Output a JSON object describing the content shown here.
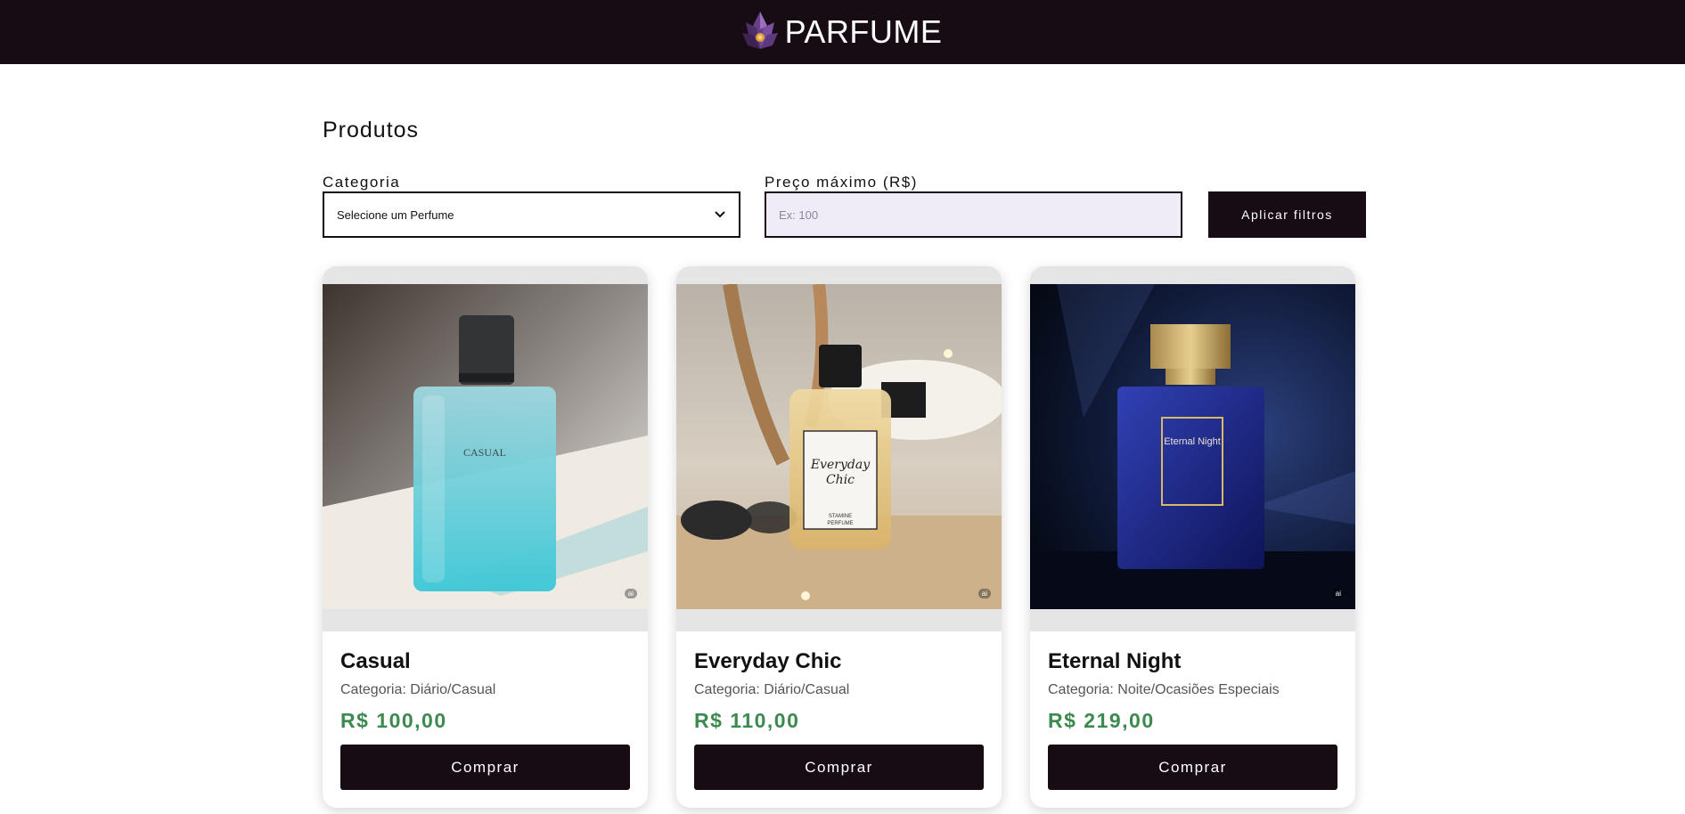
{
  "header": {
    "brand_name": "PARFUME",
    "logo_icon": "crystal-flower-logo"
  },
  "main": {
    "title": "Produtos",
    "filters": {
      "category_label": "Categoria",
      "category_selected": "Selecione um Perfume",
      "price_label": "Preço máximo (R$)",
      "price_placeholder": "Ex: 100",
      "apply_label": "Aplicar filtros"
    }
  },
  "products": [
    {
      "name": "Casual",
      "category": "Categoria: Diário/Casual",
      "price": "R$ 100,00",
      "buy_label": "Comprar",
      "bottle_label": "CASUAL",
      "ai_badge": "ai"
    },
    {
      "name": "Everyday Chic",
      "category": "Categoria: Diário/Casual",
      "price": "R$ 110,00",
      "buy_label": "Comprar",
      "bottle_label_line1": "Everyday",
      "bottle_label_line2": "Chic",
      "bottle_sublabel_line1": "STAMINE",
      "bottle_sublabel_line2": "PERFUME",
      "ai_badge": "ai"
    },
    {
      "name": "Eternal Night",
      "category": "Categoria: Noite/Ocasiões Especiais",
      "price": "R$ 219,00",
      "buy_label": "Comprar",
      "bottle_label": "Eternal Night",
      "ai_badge": "ai"
    }
  ],
  "colors": {
    "header_bg": "#170c14",
    "button_bg": "#170c14",
    "price_green": "#3c8a4f",
    "input_bg": "#efecf8"
  }
}
